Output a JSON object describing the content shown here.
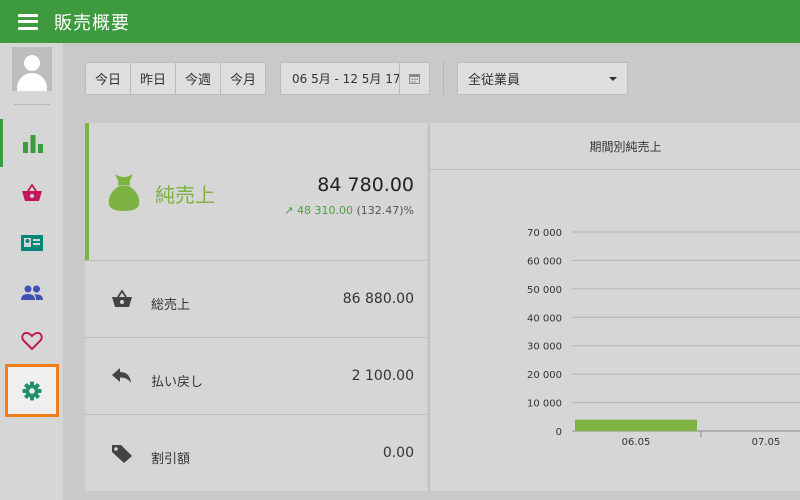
{
  "header": {
    "title": "販売概要",
    "menu_icon": "hamburger-menu-icon",
    "color": "#3d9a3f"
  },
  "sidebar": {
    "avatar_icon": "user-avatar-icon",
    "items": [
      {
        "name": "reports",
        "icon": "bar-chart-icon",
        "active": true,
        "color": "#3d9a3f"
      },
      {
        "name": "sales",
        "icon": "basket-icon",
        "color": "#c2185b"
      },
      {
        "name": "customers-card",
        "icon": "id-card-icon",
        "color": "#00897b"
      },
      {
        "name": "employees",
        "icon": "people-icon",
        "color": "#3f51b5"
      },
      {
        "name": "favorites",
        "icon": "heart-icon",
        "color": "#c2185b"
      },
      {
        "name": "settings",
        "icon": "gear-icon",
        "highlighted": true,
        "color": "#1f8f6a"
      }
    ]
  },
  "toolbar": {
    "period_buttons": [
      "今日",
      "昨日",
      "今週",
      "今月"
    ],
    "date_range": "06 5月 - 12 5月 17",
    "calendar_icon": "calendar-icon",
    "employee_select": "全従業員"
  },
  "summary": {
    "net_sales": {
      "label": "純売上",
      "value": "84 780.00",
      "change": "48 310.00",
      "change_pct": "(132.47)%",
      "icon": "money-bag-icon"
    },
    "rows": [
      {
        "label": "総売上",
        "value": "86 880.00",
        "icon": "basket-icon"
      },
      {
        "label": "払い戻し",
        "value": "2 100.00",
        "icon": "reply-arrow-icon"
      },
      {
        "label": "割引額",
        "value": "0.00",
        "icon": "tag-icon"
      }
    ]
  },
  "chart": {
    "title": "期間別純売上"
  },
  "chart_data": {
    "type": "bar",
    "title": "期間別純売上",
    "categories": [
      "06.05",
      "07.05"
    ],
    "values": [
      4000,
      null
    ],
    "ylim": [
      0,
      70000
    ],
    "yticks": [
      "0",
      "10 000",
      "20 000",
      "30 000",
      "40 000",
      "50 000",
      "60 000",
      "70 000"
    ],
    "grid": true,
    "bar_color": "#7cb342"
  }
}
